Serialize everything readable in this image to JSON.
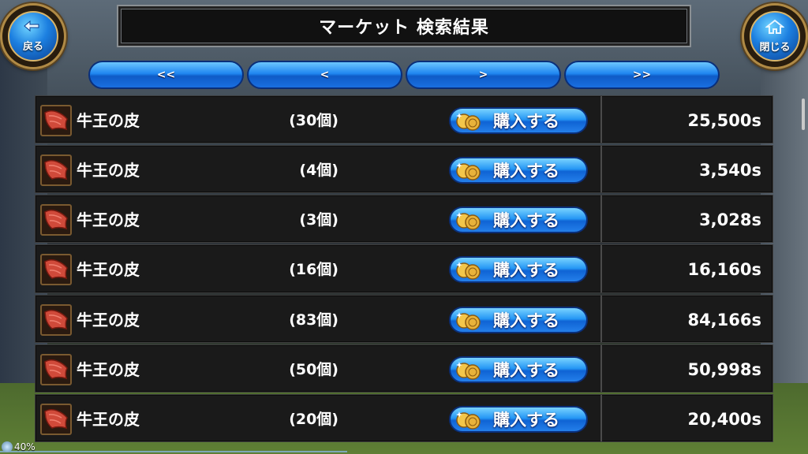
{
  "header": {
    "title": "マーケット 検索結果",
    "back_label": "戻る",
    "close_label": "閉じる"
  },
  "pager": {
    "first": "<<",
    "prev": "<",
    "next": ">",
    "last": ">>"
  },
  "buy_label": "購入する",
  "items": [
    {
      "name": "牛王の皮",
      "qty": "(30個)",
      "price": "25,500s"
    },
    {
      "name": "牛王の皮",
      "qty": "(4個)",
      "price": "3,540s"
    },
    {
      "name": "牛王の皮",
      "qty": "(3個)",
      "price": "3,028s"
    },
    {
      "name": "牛王の皮",
      "qty": "(16個)",
      "price": "16,160s"
    },
    {
      "name": "牛王の皮",
      "qty": "(83個)",
      "price": "84,166s"
    },
    {
      "name": "牛王の皮",
      "qty": "(50個)",
      "price": "50,998s"
    },
    {
      "name": "牛王の皮",
      "qty": "(20個)",
      "price": "20,400s"
    }
  ],
  "status": {
    "battery": "40%"
  },
  "icons": {
    "back": "back-arrow-icon",
    "close": "home-icon",
    "item": "hide-icon",
    "coin": "coin-icon"
  }
}
